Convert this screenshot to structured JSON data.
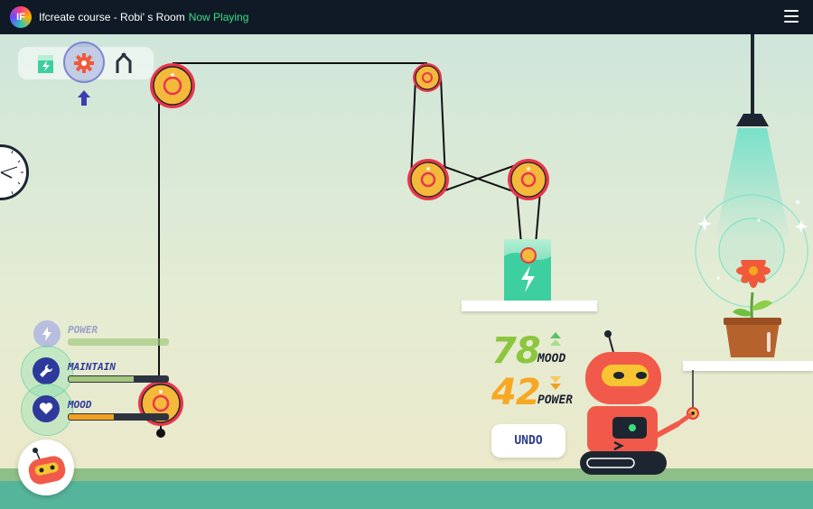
{
  "topbar": {
    "logo_text": "IF",
    "title": "Ifcreate course - Robi' s Room",
    "status": "Now Playing"
  },
  "toolbar": {
    "tools": [
      {
        "name": "battery-tool",
        "icon": "battery-icon"
      },
      {
        "name": "gear-tool",
        "icon": "gear-icon",
        "selected": true
      },
      {
        "name": "claw-tool",
        "icon": "claw-icon"
      }
    ]
  },
  "stats": [
    {
      "label": "POWER",
      "icon": "lightning-icon",
      "level": 1.0,
      "color": "#a4c87f",
      "active": false
    },
    {
      "label": "MAINTAIN",
      "icon": "wrench-icon",
      "level": 0.65,
      "color": "#a4c87f",
      "active": true
    },
    {
      "label": "MOOD",
      "icon": "heart-icon",
      "level": 0.45,
      "color": "#f0a020",
      "active": true
    }
  ],
  "scores": {
    "mood_value": "78",
    "mood_label": "MOOD",
    "power_value": "42",
    "power_label": "POWER"
  },
  "colors": {
    "mood_value": "#8cc63f",
    "power_value": "#f7a823",
    "gear_ring": "#e8364d",
    "gear_fill": "#f4b83a",
    "robot_body": "#f15a4a"
  },
  "actions": {
    "undo_label": "UNDO"
  }
}
